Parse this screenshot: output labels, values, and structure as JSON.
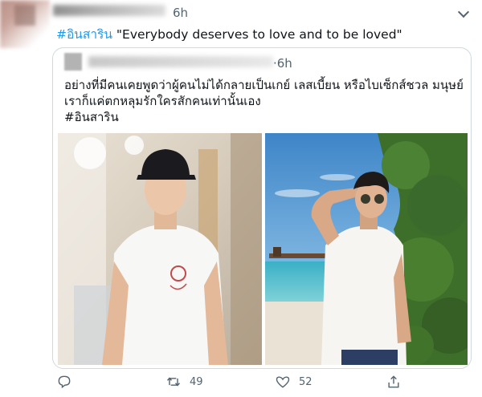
{
  "tweet": {
    "time": "6h",
    "hashtag": "#อินสาริน",
    "text": "\"Everybody deserves to love and to be loved\""
  },
  "quoted": {
    "time": "·6h",
    "line1": "อย่างที่มีคนเคยพูดว่าผู้คนไม่ได้กลายเป็นเกย์ เลสเบี้ยน หรือไบเซ็กส์ชวล มนุษย์",
    "line2": "เราก็แค่ตกหลุมรักใครสักคนเท่านั้นเอง",
    "hashtag": "#อินสาริน"
  },
  "actions": {
    "retweets": "49",
    "likes": "52"
  },
  "icons": [
    "reply-icon",
    "retweet-icon",
    "like-icon",
    "share-icon",
    "chevron-down-icon"
  ]
}
